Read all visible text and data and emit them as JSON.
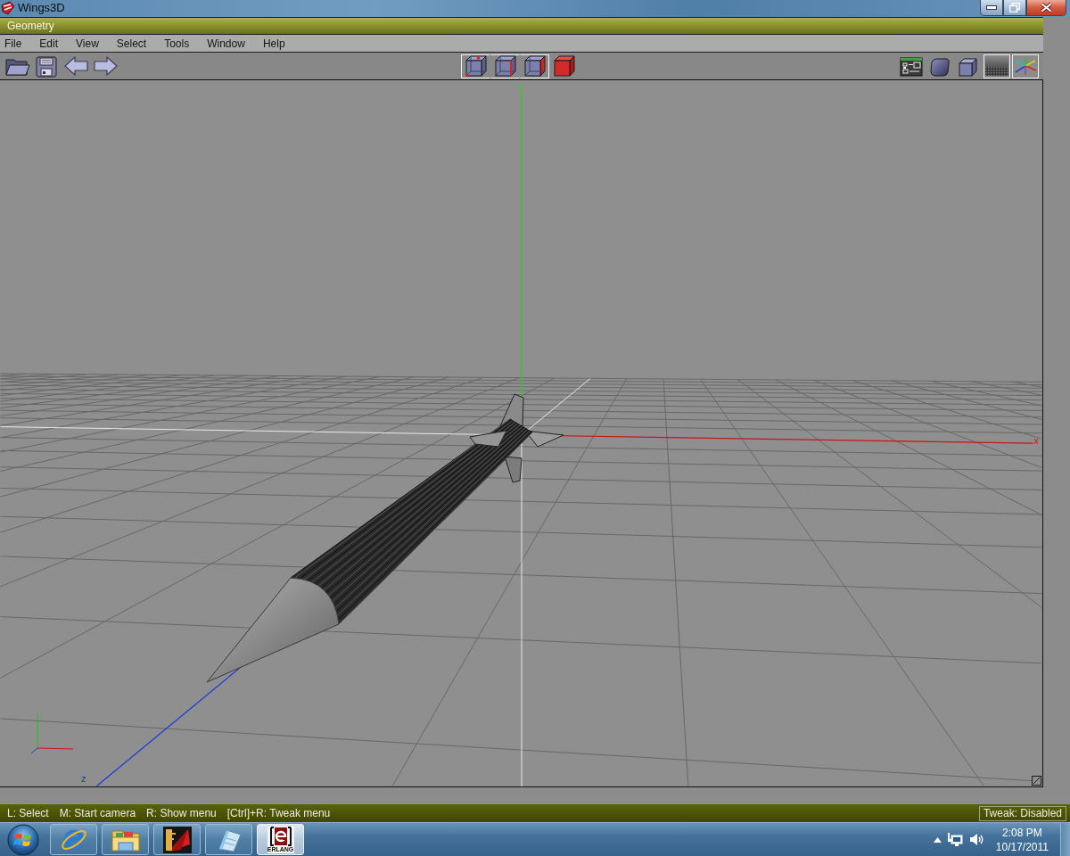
{
  "window": {
    "title": "Wings3D",
    "controls": [
      {
        "kind": "minimize"
      },
      {
        "kind": "restore"
      },
      {
        "kind": "close"
      }
    ]
  },
  "panel": {
    "title": "Geometry"
  },
  "menu": [
    "File",
    "Edit",
    "View",
    "Select",
    "Tools",
    "Window",
    "Help"
  ],
  "toolbar": {
    "file_buttons": [
      {
        "kind": "open"
      },
      {
        "kind": "save"
      },
      {
        "kind": "undo"
      },
      {
        "kind": "redo"
      }
    ],
    "selection_modes": [
      {
        "kind": "vertex",
        "selected": true
      },
      {
        "kind": "edge",
        "selected": true
      },
      {
        "kind": "face",
        "selected": true
      },
      {
        "kind": "body",
        "selected": false
      }
    ],
    "view_buttons": [
      {
        "kind": "outliner",
        "on": false
      },
      {
        "kind": "smooth",
        "on": false
      },
      {
        "kind": "flat",
        "on": false
      },
      {
        "kind": "ground",
        "on": true
      },
      {
        "kind": "axes",
        "on": true
      }
    ]
  },
  "viewport": {
    "axes": [
      {
        "kind": "vertical",
        "label": "y"
      },
      {
        "kind": "horizontal",
        "label": "x"
      },
      {
        "kind": "depth",
        "label": "z"
      }
    ]
  },
  "status_bar": {
    "hints": [
      "L: Select",
      "M: Start camera",
      "R: Show menu",
      "[Ctrl]+R: Tweak menu"
    ],
    "tweak": "Tweak: Disabled"
  },
  "taskbar": {
    "apps": [
      {
        "kind": "browser",
        "selected": false
      },
      {
        "kind": "folder",
        "selected": false
      },
      {
        "kind": "wings",
        "selected": false
      },
      {
        "kind": "notepad",
        "selected": false
      },
      {
        "kind": "erlang",
        "caption": "ERLANG",
        "selected": true
      }
    ],
    "clock": {
      "time": "2:08 PM",
      "date": "10/17/2011"
    }
  }
}
